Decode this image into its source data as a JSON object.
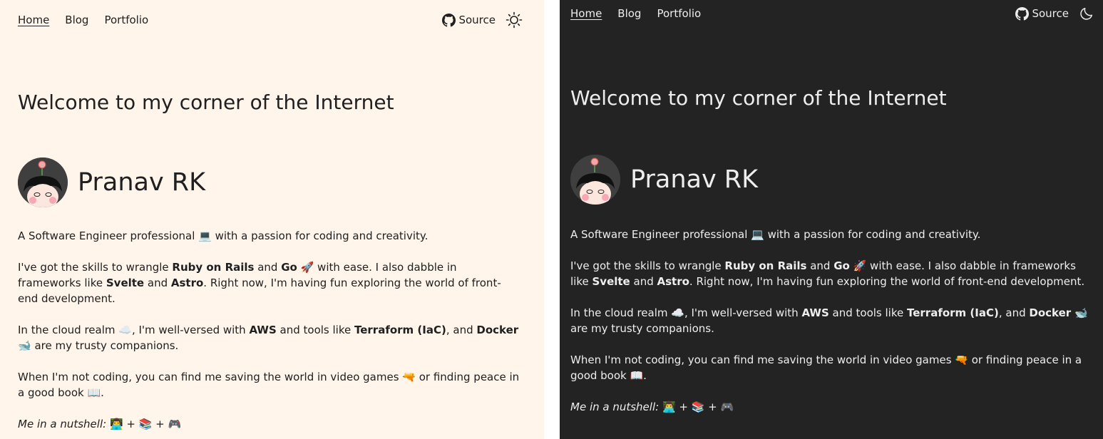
{
  "nav": {
    "home": "Home",
    "blog": "Blog",
    "portfolio": "Portfolio"
  },
  "header": {
    "source_label": "Source"
  },
  "welcome_title": "Welcome to my corner of the Internet",
  "profile": {
    "name": "Pranav RK"
  },
  "intro": {
    "p1": {
      "text": "A Software Engineer professional 💻 with a passion for coding and creativity."
    },
    "p2": {
      "t1": "I've got the skills to wrangle ",
      "b1": "Ruby on Rails",
      "t2": " and ",
      "b2": "Go",
      "t3": " 🚀 with ease. I also dabble in frameworks like ",
      "b3": "Svelte",
      "t4": " and ",
      "b4": "Astro",
      "t5": ". Right now, I'm having fun exploring the world of front-end development."
    },
    "p3": {
      "t1": "In the cloud realm ☁️, I'm well-versed with ",
      "b1": "AWS",
      "t2": " and tools like ",
      "b2": "Terraform (IaC)",
      "t3": ", and ",
      "b3": "Docker",
      "t4": " 🐋 are my trusty companions."
    },
    "p4": {
      "text": "When I'm not coding, you can find me saving the world in video games 🔫 or finding peace in a good book 📖."
    },
    "p5": {
      "label": "Me in a nutshell:",
      "emojis": " 👨‍💻 + 📚 + 🎮"
    }
  },
  "icons": {
    "github": "github-icon",
    "light_theme": "sun-icon",
    "dark_theme": "moon-icon",
    "avatar": "avatar-illustration"
  },
  "colors": {
    "light_bg": "#fff5eb",
    "dark_bg": "#232323",
    "light_text": "#202020",
    "dark_text": "#eeeeee"
  }
}
